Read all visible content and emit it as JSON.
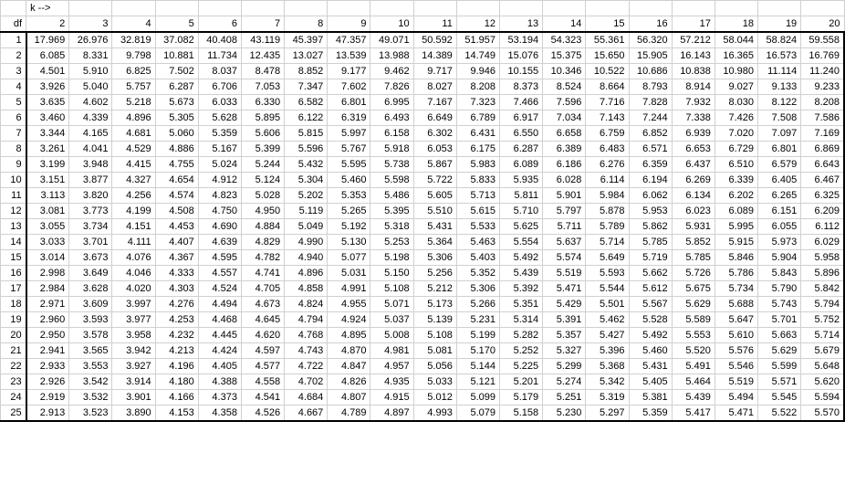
{
  "header": {
    "col0_row0": "",
    "k_label": "k -->",
    "df_label": "df"
  },
  "chart_data": {
    "type": "table",
    "title": "Studentized range / critical values table",
    "k_values": [
      2,
      3,
      4,
      5,
      6,
      7,
      8,
      9,
      10,
      11,
      12,
      13,
      14,
      15,
      16,
      17,
      18,
      19,
      20
    ],
    "df_values": [
      1,
      2,
      3,
      4,
      5,
      6,
      7,
      8,
      9,
      10,
      11,
      12,
      13,
      14,
      15,
      16,
      17,
      18,
      19,
      20,
      21,
      22,
      23,
      24,
      25
    ],
    "rows": [
      [
        "17.969",
        "26.976",
        "32.819",
        "37.082",
        "40.408",
        "43.119",
        "45.397",
        "47.357",
        "49.071",
        "50.592",
        "51.957",
        "53.194",
        "54.323",
        "55.361",
        "56.320",
        "57.212",
        "58.044",
        "58.824",
        "59.558"
      ],
      [
        "6.085",
        "8.331",
        "9.798",
        "10.881",
        "11.734",
        "12.435",
        "13.027",
        "13.539",
        "13.988",
        "14.389",
        "14.749",
        "15.076",
        "15.375",
        "15.650",
        "15.905",
        "16.143",
        "16.365",
        "16.573",
        "16.769"
      ],
      [
        "4.501",
        "5.910",
        "6.825",
        "7.502",
        "8.037",
        "8.478",
        "8.852",
        "9.177",
        "9.462",
        "9.717",
        "9.946",
        "10.155",
        "10.346",
        "10.522",
        "10.686",
        "10.838",
        "10.980",
        "11.114",
        "11.240"
      ],
      [
        "3.926",
        "5.040",
        "5.757",
        "6.287",
        "6.706",
        "7.053",
        "7.347",
        "7.602",
        "7.826",
        "8.027",
        "8.208",
        "8.373",
        "8.524",
        "8.664",
        "8.793",
        "8.914",
        "9.027",
        "9.133",
        "9.233"
      ],
      [
        "3.635",
        "4.602",
        "5.218",
        "5.673",
        "6.033",
        "6.330",
        "6.582",
        "6.801",
        "6.995",
        "7.167",
        "7.323",
        "7.466",
        "7.596",
        "7.716",
        "7.828",
        "7.932",
        "8.030",
        "8.122",
        "8.208"
      ],
      [
        "3.460",
        "4.339",
        "4.896",
        "5.305",
        "5.628",
        "5.895",
        "6.122",
        "6.319",
        "6.493",
        "6.649",
        "6.789",
        "6.917",
        "7.034",
        "7.143",
        "7.244",
        "7.338",
        "7.426",
        "7.508",
        "7.586"
      ],
      [
        "3.344",
        "4.165",
        "4.681",
        "5.060",
        "5.359",
        "5.606",
        "5.815",
        "5.997",
        "6.158",
        "6.302",
        "6.431",
        "6.550",
        "6.658",
        "6.759",
        "6.852",
        "6.939",
        "7.020",
        "7.097",
        "7.169"
      ],
      [
        "3.261",
        "4.041",
        "4.529",
        "4.886",
        "5.167",
        "5.399",
        "5.596",
        "5.767",
        "5.918",
        "6.053",
        "6.175",
        "6.287",
        "6.389",
        "6.483",
        "6.571",
        "6.653",
        "6.729",
        "6.801",
        "6.869"
      ],
      [
        "3.199",
        "3.948",
        "4.415",
        "4.755",
        "5.024",
        "5.244",
        "5.432",
        "5.595",
        "5.738",
        "5.867",
        "5.983",
        "6.089",
        "6.186",
        "6.276",
        "6.359",
        "6.437",
        "6.510",
        "6.579",
        "6.643"
      ],
      [
        "3.151",
        "3.877",
        "4.327",
        "4.654",
        "4.912",
        "5.124",
        "5.304",
        "5.460",
        "5.598",
        "5.722",
        "5.833",
        "5.935",
        "6.028",
        "6.114",
        "6.194",
        "6.269",
        "6.339",
        "6.405",
        "6.467"
      ],
      [
        "3.113",
        "3.820",
        "4.256",
        "4.574",
        "4.823",
        "5.028",
        "5.202",
        "5.353",
        "5.486",
        "5.605",
        "5.713",
        "5.811",
        "5.901",
        "5.984",
        "6.062",
        "6.134",
        "6.202",
        "6.265",
        "6.325"
      ],
      [
        "3.081",
        "3.773",
        "4.199",
        "4.508",
        "4.750",
        "4.950",
        "5.119",
        "5.265",
        "5.395",
        "5.510",
        "5.615",
        "5.710",
        "5.797",
        "5.878",
        "5.953",
        "6.023",
        "6.089",
        "6.151",
        "6.209"
      ],
      [
        "3.055",
        "3.734",
        "4.151",
        "4.453",
        "4.690",
        "4.884",
        "5.049",
        "5.192",
        "5.318",
        "5.431",
        "5.533",
        "5.625",
        "5.711",
        "5.789",
        "5.862",
        "5.931",
        "5.995",
        "6.055",
        "6.112"
      ],
      [
        "3.033",
        "3.701",
        "4.111",
        "4.407",
        "4.639",
        "4.829",
        "4.990",
        "5.130",
        "5.253",
        "5.364",
        "5.463",
        "5.554",
        "5.637",
        "5.714",
        "5.785",
        "5.852",
        "5.915",
        "5.973",
        "6.029"
      ],
      [
        "3.014",
        "3.673",
        "4.076",
        "4.367",
        "4.595",
        "4.782",
        "4.940",
        "5.077",
        "5.198",
        "5.306",
        "5.403",
        "5.492",
        "5.574",
        "5.649",
        "5.719",
        "5.785",
        "5.846",
        "5.904",
        "5.958"
      ],
      [
        "2.998",
        "3.649",
        "4.046",
        "4.333",
        "4.557",
        "4.741",
        "4.896",
        "5.031",
        "5.150",
        "5.256",
        "5.352",
        "5.439",
        "5.519",
        "5.593",
        "5.662",
        "5.726",
        "5.786",
        "5.843",
        "5.896"
      ],
      [
        "2.984",
        "3.628",
        "4.020",
        "4.303",
        "4.524",
        "4.705",
        "4.858",
        "4.991",
        "5.108",
        "5.212",
        "5.306",
        "5.392",
        "5.471",
        "5.544",
        "5.612",
        "5.675",
        "5.734",
        "5.790",
        "5.842"
      ],
      [
        "2.971",
        "3.609",
        "3.997",
        "4.276",
        "4.494",
        "4.673",
        "4.824",
        "4.955",
        "5.071",
        "5.173",
        "5.266",
        "5.351",
        "5.429",
        "5.501",
        "5.567",
        "5.629",
        "5.688",
        "5.743",
        "5.794"
      ],
      [
        "2.960",
        "3.593",
        "3.977",
        "4.253",
        "4.468",
        "4.645",
        "4.794",
        "4.924",
        "5.037",
        "5.139",
        "5.231",
        "5.314",
        "5.391",
        "5.462",
        "5.528",
        "5.589",
        "5.647",
        "5.701",
        "5.752"
      ],
      [
        "2.950",
        "3.578",
        "3.958",
        "4.232",
        "4.445",
        "4.620",
        "4.768",
        "4.895",
        "5.008",
        "5.108",
        "5.199",
        "5.282",
        "5.357",
        "5.427",
        "5.492",
        "5.553",
        "5.610",
        "5.663",
        "5.714"
      ],
      [
        "2.941",
        "3.565",
        "3.942",
        "4.213",
        "4.424",
        "4.597",
        "4.743",
        "4.870",
        "4.981",
        "5.081",
        "5.170",
        "5.252",
        "5.327",
        "5.396",
        "5.460",
        "5.520",
        "5.576",
        "5.629",
        "5.679"
      ],
      [
        "2.933",
        "3.553",
        "3.927",
        "4.196",
        "4.405",
        "4.577",
        "4.722",
        "4.847",
        "4.957",
        "5.056",
        "5.144",
        "5.225",
        "5.299",
        "5.368",
        "5.431",
        "5.491",
        "5.546",
        "5.599",
        "5.648"
      ],
      [
        "2.926",
        "3.542",
        "3.914",
        "4.180",
        "4.388",
        "4.558",
        "4.702",
        "4.826",
        "4.935",
        "5.033",
        "5.121",
        "5.201",
        "5.274",
        "5.342",
        "5.405",
        "5.464",
        "5.519",
        "5.571",
        "5.620"
      ],
      [
        "2.919",
        "3.532",
        "3.901",
        "4.166",
        "4.373",
        "4.541",
        "4.684",
        "4.807",
        "4.915",
        "5.012",
        "5.099",
        "5.179",
        "5.251",
        "5.319",
        "5.381",
        "5.439",
        "5.494",
        "5.545",
        "5.594"
      ],
      [
        "2.913",
        "3.523",
        "3.890",
        "4.153",
        "4.358",
        "4.526",
        "4.667",
        "4.789",
        "4.897",
        "4.993",
        "5.079",
        "5.158",
        "5.230",
        "5.297",
        "5.359",
        "5.417",
        "5.471",
        "5.522",
        "5.570"
      ]
    ]
  }
}
